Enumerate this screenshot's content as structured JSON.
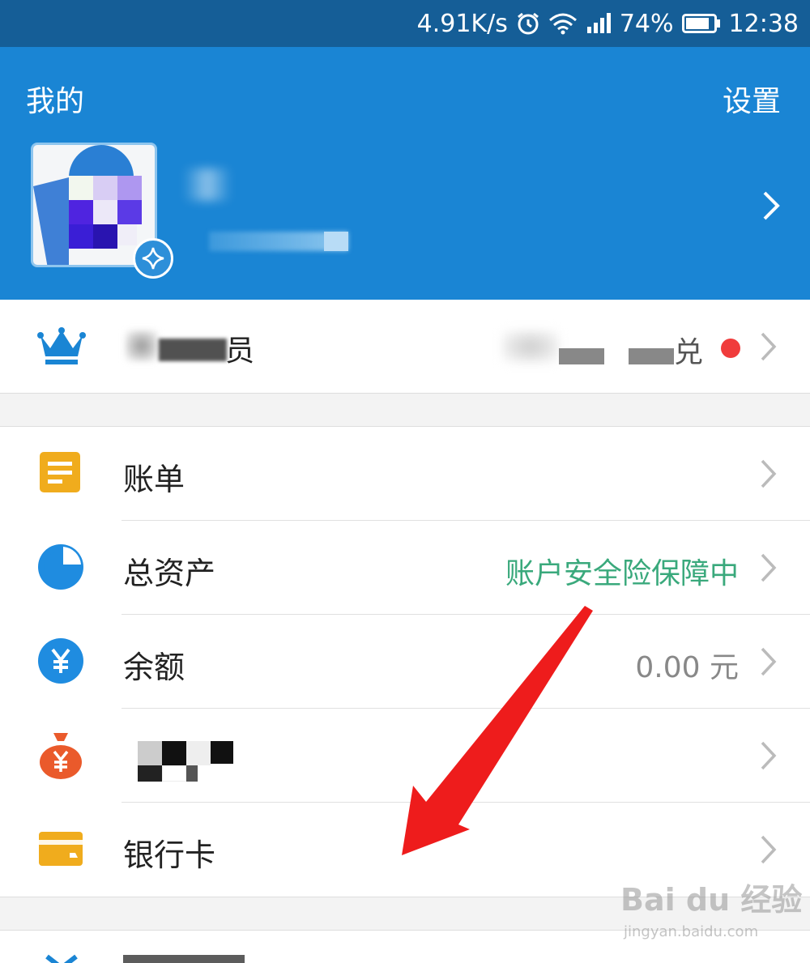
{
  "status_bar": {
    "speed": "4.91K/s",
    "battery": "74%",
    "time": "12:38",
    "icons": [
      "alarm-icon",
      "wifi-icon",
      "signal-icon",
      "battery-icon"
    ]
  },
  "header": {
    "title": "我的",
    "settings_label": "设置"
  },
  "member_row": {
    "icon": "crown-icon",
    "label_visible_fragment": "员",
    "right_visible_fragment": "兑"
  },
  "list": {
    "items": [
      {
        "icon": "bill-icon",
        "label": "账单",
        "value": ""
      },
      {
        "icon": "pie-chart-icon",
        "label": "总资产",
        "value": "账户安全险保障中"
      },
      {
        "icon": "yuan-icon",
        "label": "余额",
        "value": "0.00 元"
      },
      {
        "icon": "money-bag-icon",
        "label": "",
        "value": ""
      },
      {
        "icon": "bank-card-icon",
        "label": "银行卡",
        "value": ""
      }
    ]
  },
  "watermark": {
    "brand": "Bai du 经验",
    "url": "jingyan.baidu.com"
  },
  "colors": {
    "status_bar": "#155e97",
    "header": "#1a85d4",
    "value_green": "#3aa97c",
    "value_gray": "#888888",
    "red_dot": "#f03c3c",
    "arrow_red": "#ee1c1c"
  }
}
